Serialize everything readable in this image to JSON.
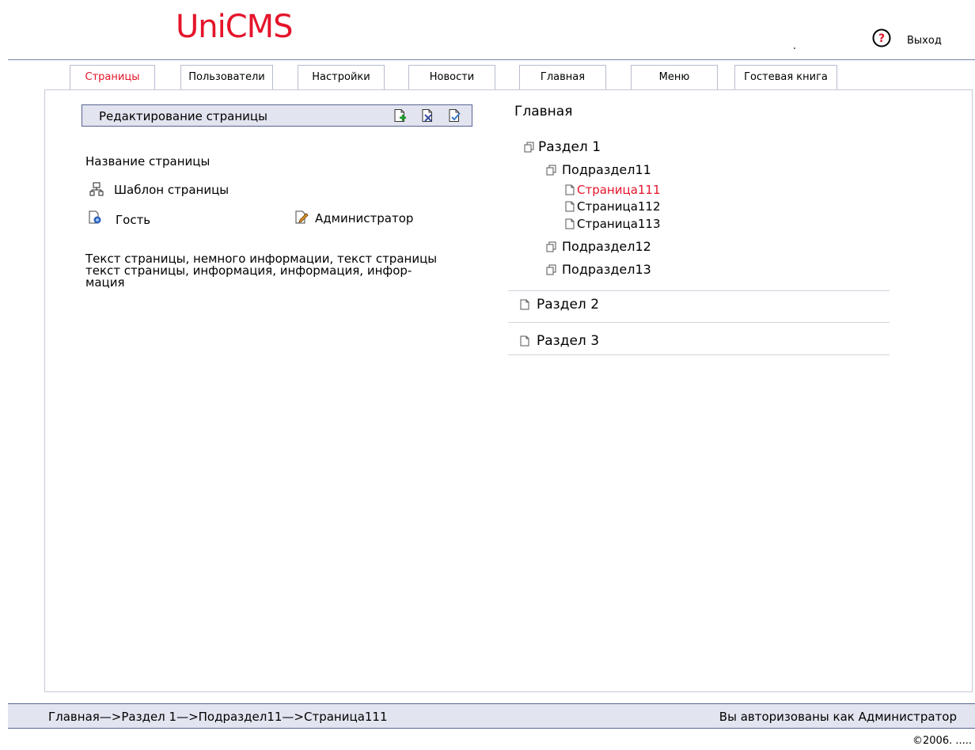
{
  "header": {
    "logo": "UniCMS",
    "help_label": "?",
    "exit_label": "Выход"
  },
  "tabs": [
    {
      "label": "Страницы",
      "active": true
    },
    {
      "label": "Пользователи"
    },
    {
      "label": "Настройки"
    },
    {
      "label": "Новости"
    },
    {
      "label": "Главная"
    },
    {
      "label": "Меню"
    },
    {
      "label": "Гостевая книга"
    }
  ],
  "editor": {
    "title": "Редактирование страницы",
    "toolbar_icons": [
      "add-page-icon",
      "delete-page-icon",
      "save-page-icon"
    ],
    "page_name_label": "Название страницы",
    "template_label": "Шаблон страницы",
    "guest_label": "Гость",
    "admin_label": "Администратор",
    "body_text": [
      "Текст страницы, немного информации, текст страницы",
      "текст страницы, информация, информация, инфор-",
      "мация"
    ]
  },
  "tree": {
    "root": "Главная",
    "items": [
      {
        "label": "Раздел 1",
        "icon": "folder-icon"
      },
      {
        "label": "Подраздел11",
        "icon": "folder-icon"
      },
      {
        "label": "Страница111",
        "icon": "page-icon",
        "selected": true
      },
      {
        "label": "Страница112",
        "icon": "page-icon"
      },
      {
        "label": "Страница113",
        "icon": "page-icon"
      },
      {
        "label": "Подраздел12",
        "icon": "folder-icon"
      },
      {
        "label": "Подраздел13",
        "icon": "folder-icon"
      },
      {
        "label": "Раздел 2",
        "icon": "page-icon"
      },
      {
        "label": "Раздел 3",
        "icon": "page-icon"
      }
    ]
  },
  "status": {
    "breadcrumb": "Главная—>Раздел 1—>Подраздел11—>Страница111",
    "auth": "Вы авторизованы как Администратор"
  },
  "footer": {
    "copyright": "©2006. ....."
  },
  "colors": {
    "accent": "#e5142a",
    "border": "#5a6494",
    "bar_background": "#e2e4ef"
  }
}
